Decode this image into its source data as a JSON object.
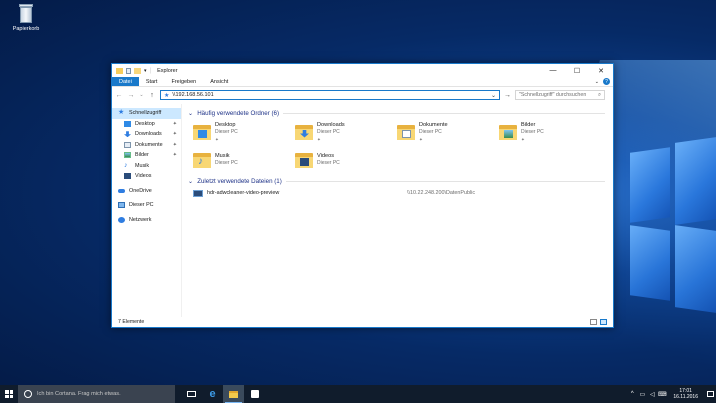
{
  "desktop": {
    "icons": [
      {
        "label": "Papierkorb",
        "icon": "recycle-bin-icon"
      }
    ]
  },
  "window": {
    "title": "Explorer",
    "controls": {
      "minimize": "—",
      "maximize": "☐",
      "close": "✕"
    },
    "ribbon_tabs": [
      "Datei",
      "Start",
      "Freigeben",
      "Ansicht"
    ],
    "help": "?",
    "address": "\\\\192.168.56.101",
    "search_placeholder": "\"Schnellzugriff\" durchsuchen",
    "sidebar": [
      {
        "label": "Schnellzugriff",
        "icon": "star-icon",
        "selected": true
      },
      {
        "label": "Desktop",
        "icon": "desktop-folder-icon",
        "pinned": true
      },
      {
        "label": "Downloads",
        "icon": "downloads-icon",
        "pinned": true
      },
      {
        "label": "Dokumente",
        "icon": "documents-icon",
        "pinned": true
      },
      {
        "label": "Bilder",
        "icon": "pictures-icon",
        "pinned": true
      },
      {
        "label": "Musik",
        "icon": "music-icon"
      },
      {
        "label": "Videos",
        "icon": "videos-icon"
      },
      {
        "label": "OneDrive",
        "icon": "onedrive-icon"
      },
      {
        "label": "Dieser PC",
        "icon": "this-pc-icon"
      },
      {
        "label": "Netzwerk",
        "icon": "network-icon"
      }
    ],
    "frequent": {
      "header": "Häufig verwendete Ordner (6)",
      "folders": [
        {
          "name": "Desktop",
          "location": "Dieser PC",
          "badge": "desktop"
        },
        {
          "name": "Downloads",
          "location": "Dieser PC",
          "badge": "downloads"
        },
        {
          "name": "Dokumente",
          "location": "Dieser PC",
          "badge": "documents"
        },
        {
          "name": "Bilder",
          "location": "Dieser PC",
          "badge": "pictures"
        },
        {
          "name": "Musik",
          "location": "Dieser PC",
          "badge": "music"
        },
        {
          "name": "Videos",
          "location": "Dieser PC",
          "badge": "videos"
        }
      ]
    },
    "recent": {
      "header": "Zuletzt verwendete Dateien (1)",
      "files": [
        {
          "name": "hdr-adwcleaner-video-preview",
          "path": "\\\\10.22.248.200\\DatenPublic"
        }
      ]
    },
    "status": "7 Elemente"
  },
  "taskbar": {
    "cortana_placeholder": "Ich bin Cortana. Frag mich etwas.",
    "time": "17:01",
    "date": "16.11.2016"
  },
  "colors": {
    "accent": "#1979ca",
    "selection": "#cce8ff",
    "taskbar": "#101c2c"
  }
}
